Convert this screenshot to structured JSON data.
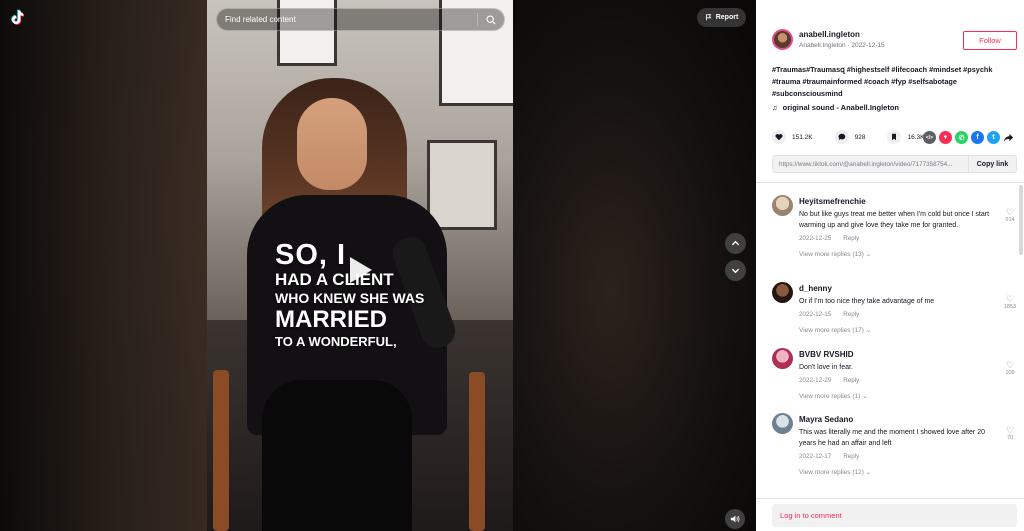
{
  "header": {
    "search_placeholder": "Find related content",
    "report_label": "Report"
  },
  "video": {
    "caption": [
      "SO, I",
      "HAD A CLIENT",
      "WHO KNEW SHE WAS",
      "MARRIED",
      "TO A WONDERFUL,"
    ]
  },
  "post": {
    "username": "anabell.ingleton",
    "display_name": "Anabell.Ingleton",
    "date": "2022-12-15",
    "follow_label": "Follow",
    "description_line1": "#Traumas#Traumasզ #highestself #lifecoach #mindset #psychk",
    "description_line2": "#trauma #traumainformed #coach #fyp #selfsabotage",
    "description_line3": "#subconsciousmind",
    "sound": "original sound - Anabell.Ingleton",
    "likes": "151.2K",
    "comments_count": "928",
    "saves": "16.3K",
    "link": "https://www.tiktok.com/@anabell.ingleton/video/7177358754...",
    "copy_label": "Copy link"
  },
  "share_icons": [
    {
      "name": "embed-icon",
      "glyph": "</>",
      "color": "#5e5f66"
    },
    {
      "name": "send-icon",
      "glyph": "▼",
      "color": "#fe2c55"
    },
    {
      "name": "whatsapp-icon",
      "glyph": "✆",
      "color": "#25d366"
    },
    {
      "name": "facebook-icon",
      "glyph": "f",
      "color": "#1877f2"
    },
    {
      "name": "twitter-icon",
      "glyph": "t",
      "color": "#1da1f2"
    }
  ],
  "comments": [
    {
      "user": "Heyitsmefrenchie",
      "text": "No but like guys treat me better when I'm cold but once I start warming up and give love they take me for granted.",
      "date": "2022-12-25",
      "reply": "Reply",
      "more": "View more replies (13) ⌄",
      "likes": "514",
      "avatar_color": "#b9a58c"
    },
    {
      "user": "d_henny",
      "text": "Or if I'm too nice they take advantage of me",
      "date": "2022-12-15",
      "reply": "Reply",
      "more": "View more replies (17) ⌄",
      "likes": "1853",
      "avatar_color": "#3a2a22"
    },
    {
      "user": "BVBV RVSHID",
      "text": "Don't love in fear.",
      "date": "2022-12-29",
      "reply": "Reply",
      "more": "View more replies (1) ⌄",
      "likes": "109",
      "avatar_color": "#c44060"
    },
    {
      "user": "Mayra Sedano",
      "text": "This was literally me and the moment I showed love after 20 years he had an affair and left",
      "date": "2022-12-17",
      "reply": "Reply",
      "more": "View more replies (12) ⌄",
      "likes": "70",
      "avatar_color": "#7a8c9a"
    }
  ],
  "login_label": "Log in to comment"
}
